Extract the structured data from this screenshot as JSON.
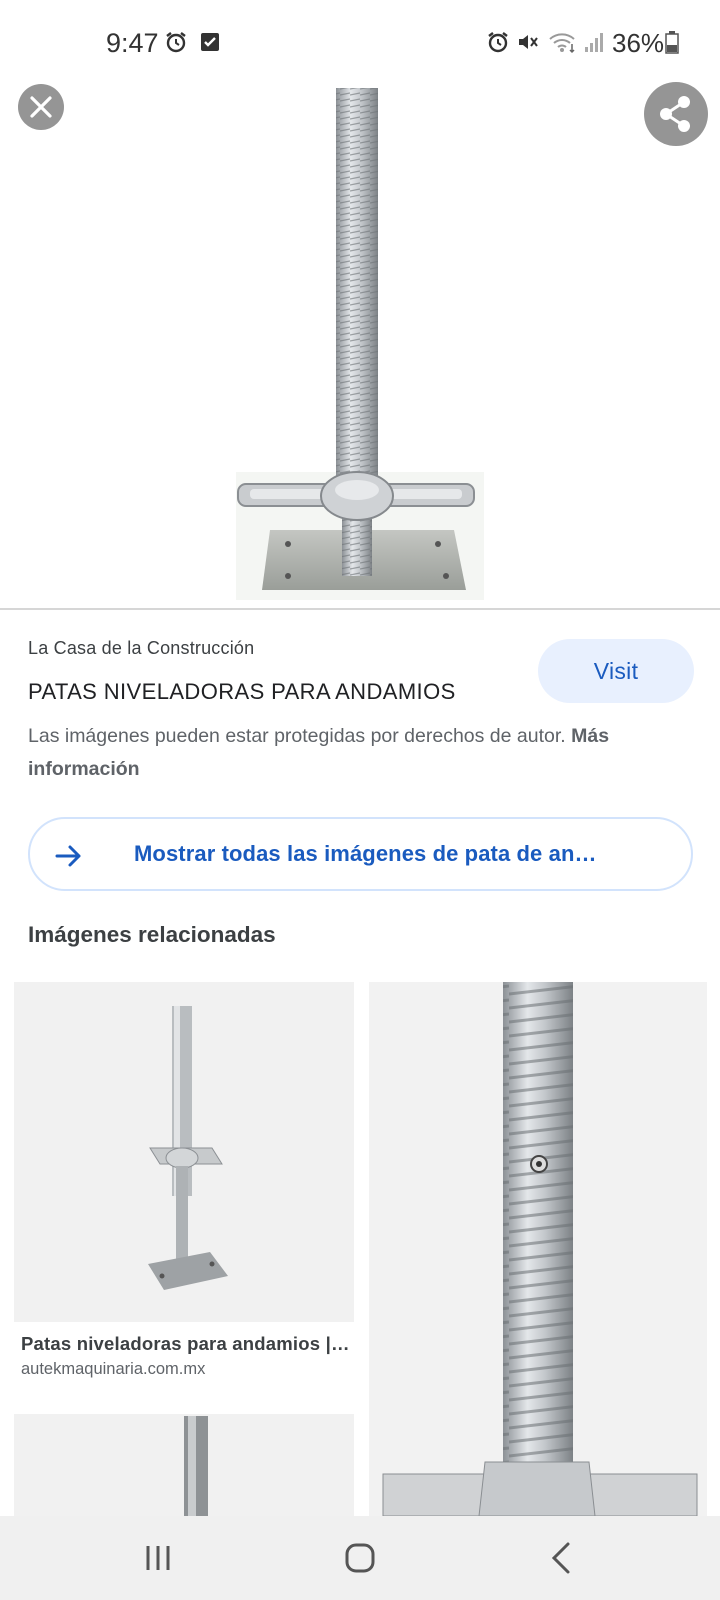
{
  "status_bar": {
    "time": "9:47",
    "left_icons": [
      "alarm-icon",
      "checkbox-icon"
    ],
    "right_icons": [
      "alarm-icon",
      "mute-icon",
      "wifi-icon",
      "signal-icon",
      "battery-icon"
    ],
    "battery": "36%"
  },
  "viewer": {
    "image_subject": "scaffold leveling jack",
    "close_icon": "close-icon",
    "share_icon": "share-icon"
  },
  "result": {
    "source": "La Casa de la Construcción",
    "title": "PATAS NIVELADORAS PARA ANDAMIOS",
    "visit_label": "Visit",
    "copyright_text": "Las imágenes pueden estar protegidas por derechos de autor.",
    "more_info_label": "Más información"
  },
  "show_all": {
    "label": "Mostrar todas las imágenes de pata de an…",
    "icon": "arrow-right-icon"
  },
  "related": {
    "heading": "Imágenes relacionadas",
    "items": [
      {
        "title": "Patas niveladoras para andamios |…",
        "domain": "autekmaquinaria.com.mx"
      }
    ]
  },
  "nav_bar": {
    "icons": [
      "recents-icon",
      "home-icon",
      "back-icon"
    ]
  },
  "colors": {
    "accent": "#1a5bbf",
    "visit_bg": "#e8f0fe",
    "nav_bg": "#f0f0f0"
  }
}
